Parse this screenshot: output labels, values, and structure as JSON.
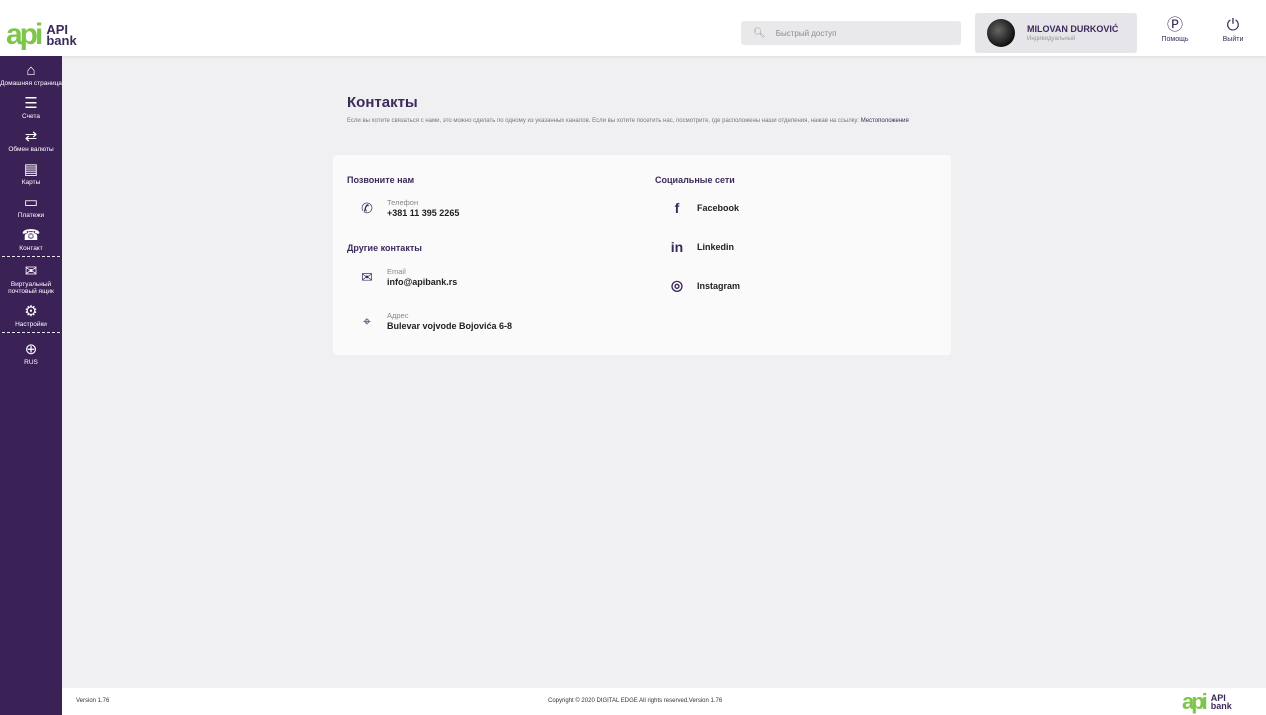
{
  "app": {
    "logo_mark": "api",
    "logo_text_1": "API",
    "logo_text_2": "bank"
  },
  "header": {
    "search_placeholder": "Быстрый доступ",
    "user_name": "MILOVAN DURKOVIĆ",
    "user_role": "Индивидуальный",
    "help_label": "Помощь",
    "logout_label": "Выйти"
  },
  "sidebar": {
    "items": [
      {
        "label": "Домашняя страница",
        "icon": "home-icon"
      },
      {
        "label": "Счета",
        "icon": "list-icon"
      },
      {
        "label": "Обмен валюты",
        "icon": "exchange-icon"
      },
      {
        "label": "Карты",
        "icon": "card-icon"
      },
      {
        "label": "Платежи",
        "icon": "wallet-icon"
      },
      {
        "label": "Контакт",
        "icon": "contact-icon"
      },
      {
        "label": "Виртуальный почтовый ящик",
        "icon": "mail-icon"
      },
      {
        "label": "Настройки",
        "icon": "gear-icon"
      },
      {
        "label": "RUS",
        "icon": "globe-icon"
      }
    ]
  },
  "page": {
    "title": "Контакты",
    "desc": "Если вы хотите связаться с нами, это можно сделать по одному из указанных каналов. Если вы хотите посетить нас, посмотрите, где расположены наши отделения, нажав на ссылку:",
    "link": "Местоположения"
  },
  "contacts": {
    "call_title": "Позвоните нам",
    "phone_label": "Телефон",
    "phone_value": "+381 11 395 2265",
    "other_title": "Другие контакты",
    "email_label": "Email",
    "email_value": "info@apibank.rs",
    "address_label": "Адрес",
    "address_value": "Bulevar vojvode Bojovića 6-8",
    "social_title": "Социальные сети",
    "facebook": "Facebook",
    "linkedin": "Linkedin",
    "instagram": "Instagram"
  },
  "footer": {
    "version": "Version 1.76",
    "copyright": "Copyright © 2020 DIGITAL EDGE All rights reserved.Version 1.76"
  },
  "colors": {
    "brand_purple": "#3a2257",
    "brand_green": "#7ec54b"
  }
}
